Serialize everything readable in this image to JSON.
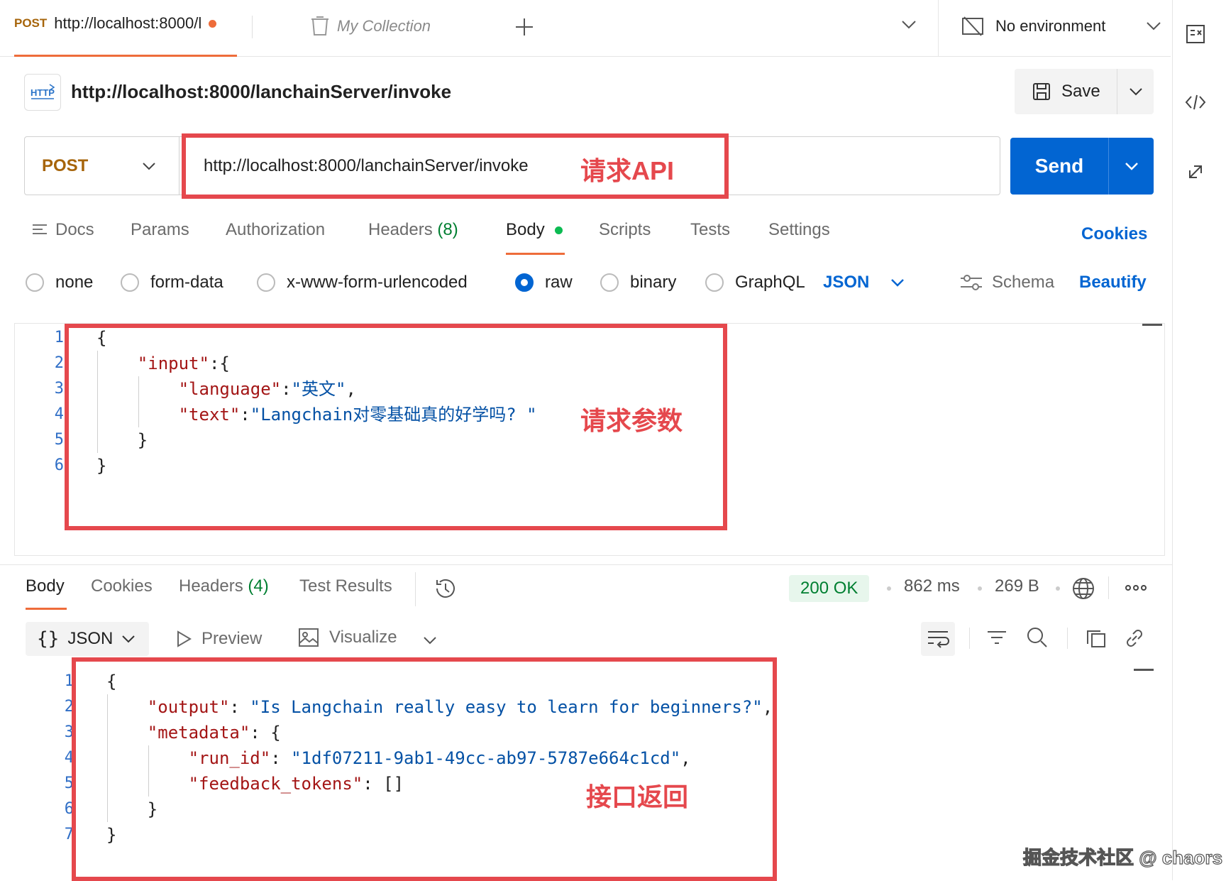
{
  "tabs": {
    "active": {
      "method": "POST",
      "title": "http://localhost:8000/l"
    },
    "collection": "My Collection",
    "environment": "No environment"
  },
  "request": {
    "title": "http://localhost:8000/lanchainServer/invoke",
    "save_label": "Save",
    "method": "POST",
    "url": "http://localhost:8000/lanchainServer/invoke",
    "send_label": "Send"
  },
  "request_tabs": {
    "docs": "Docs",
    "params": "Params",
    "authorization": "Authorization",
    "headers": "Headers",
    "headers_count": "(8)",
    "body": "Body",
    "scripts": "Scripts",
    "tests": "Tests",
    "settings": "Settings",
    "cookies": "Cookies"
  },
  "body_types": {
    "none": "none",
    "form_data": "form-data",
    "urlencoded": "x-www-form-urlencoded",
    "raw": "raw",
    "binary": "binary",
    "graphql": "GraphQL",
    "format": "JSON",
    "schema": "Schema",
    "beautify": "Beautify"
  },
  "request_body": {
    "lines": [
      "1",
      "2",
      "3",
      "4",
      "5",
      "6"
    ],
    "l1": "{",
    "l2_key": "\"input\"",
    "l2_rest": ":{",
    "l3_key": "\"language\"",
    "l3_colon": ":",
    "l3_val": "\"英文\"",
    "l3_end": ",",
    "l4_key": "\"text\"",
    "l4_colon": ":",
    "l4_val": "\"Langchain对零基础真的好学吗? \"",
    "l5": "}",
    "l6": "}"
  },
  "response_tabs": {
    "body": "Body",
    "cookies": "Cookies",
    "headers": "Headers",
    "headers_count": "(4)",
    "test_results": "Test Results",
    "status": "200 OK",
    "time": "862 ms",
    "size": "269 B",
    "format": "JSON",
    "preview": "Preview",
    "visualize": "Visualize"
  },
  "response_body": {
    "lines": [
      "1",
      "2",
      "3",
      "4",
      "5",
      "6",
      "7"
    ],
    "l1": "{",
    "l2_key": "\"output\"",
    "l2_colon": ": ",
    "l2_val": "\"Is Langchain really easy to learn for beginners?\"",
    "l2_end": ",",
    "l3_key": "\"metadata\"",
    "l3_rest": ": {",
    "l4_key": "\"run_id\"",
    "l4_colon": ": ",
    "l4_val": "\"1df07211-9ab1-49cc-ab97-5787e664c1cd\"",
    "l4_end": ",",
    "l5_key": "\"feedback_tokens\"",
    "l5_rest": ": []",
    "l6": "}",
    "l7": "}"
  },
  "annotations": {
    "api": "请求API",
    "params": "请求参数",
    "response": "接口返回"
  },
  "watermark": "掘金技术社区 @ chaors",
  "colors": {
    "accent": "#0265d2",
    "annotation": "#e5484d",
    "status_ok": "#007f31"
  }
}
